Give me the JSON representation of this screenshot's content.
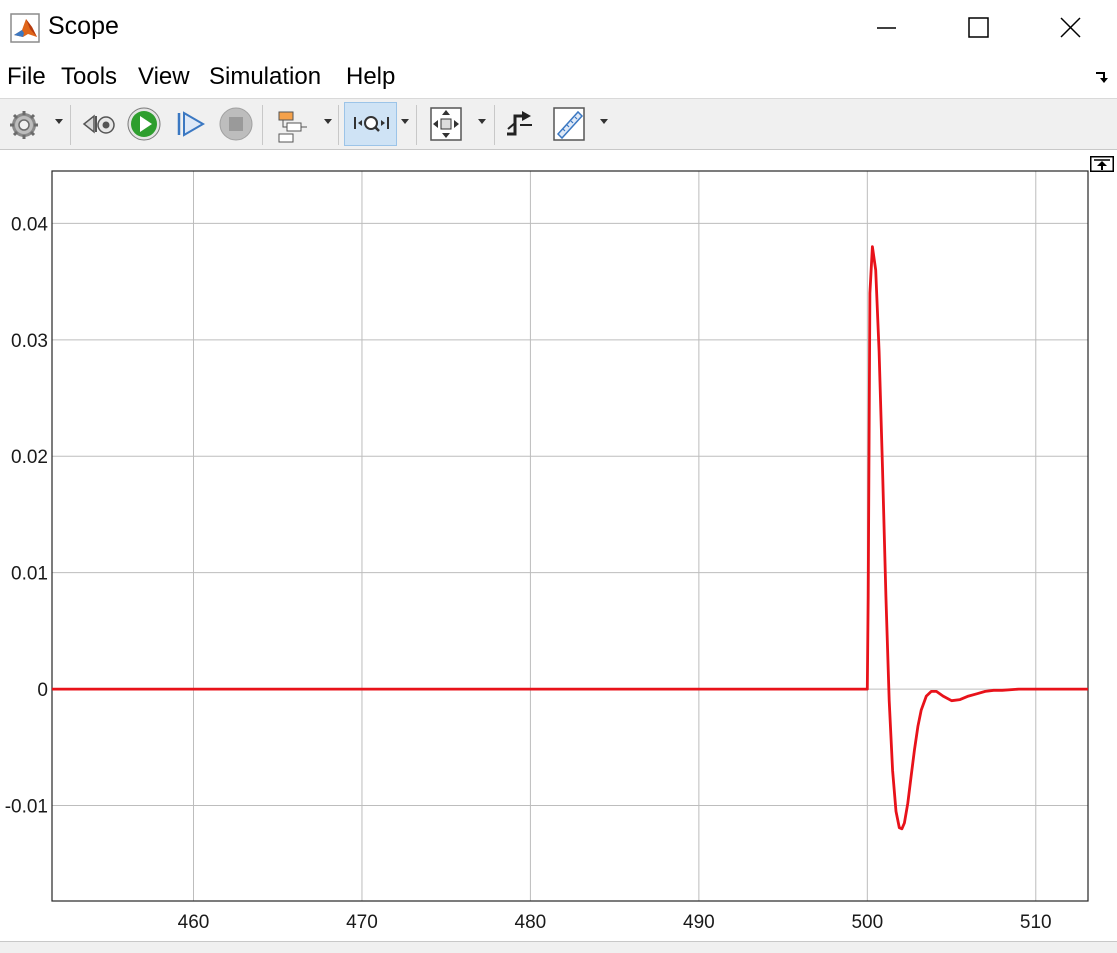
{
  "window": {
    "title": "Scope"
  },
  "menu": {
    "file": "File",
    "tools": "Tools",
    "view": "View",
    "simulation": "Simulation",
    "help": "Help"
  },
  "toolbar": {
    "icons": [
      "gear-icon",
      "step-back-icon",
      "run-icon",
      "step-forward-icon",
      "stop-icon",
      "signal-hierarchy-icon",
      "zoom-icon",
      "autoscale-icon",
      "trigger-icon",
      "measurement-ruler-icon"
    ],
    "selected": "zoom-icon"
  },
  "colors": {
    "trace": "#e8121a",
    "grid": "#bdbdbd",
    "axes": "#262626",
    "run_green": "#2e9e2e"
  },
  "chart_data": {
    "type": "line",
    "title": "",
    "xlabel": "",
    "ylabel": "",
    "xlim": [
      451.6,
      513.1
    ],
    "ylim": [
      -0.0182,
      0.0445
    ],
    "xticks": [
      460,
      470,
      480,
      490,
      500,
      510
    ],
    "xtick_labels": [
      "460",
      "470",
      "480",
      "490",
      "500",
      "510"
    ],
    "yticks": [
      -0.01,
      0,
      0.01,
      0.02,
      0.03,
      0.04
    ],
    "ytick_labels": [
      "-0.01",
      "0",
      "0.01",
      "0.02",
      "0.03",
      "0.04"
    ],
    "grid": true,
    "series": [
      {
        "color": "#e8121a",
        "x": [
          451.6,
          500.0,
          500.05,
          500.15,
          500.3,
          500.5,
          500.7,
          500.9,
          501.1,
          501.3,
          501.5,
          501.7,
          501.9,
          502.05,
          502.2,
          502.4,
          502.6,
          502.8,
          503.0,
          503.2,
          503.5,
          503.8,
          504.1,
          504.5,
          505.0,
          505.5,
          506.0,
          506.5,
          507.0,
          507.5,
          508.0,
          509.0,
          510.0,
          511.0,
          512.0,
          513.1
        ],
        "y": [
          0,
          0,
          0.008,
          0.034,
          0.038,
          0.036,
          0.029,
          0.019,
          0.008,
          -0.001,
          -0.007,
          -0.0105,
          -0.0119,
          -0.012,
          -0.0115,
          -0.0098,
          -0.0075,
          -0.0052,
          -0.0032,
          -0.0018,
          -0.0006,
          -0.0002,
          -0.0002,
          -0.0006,
          -0.001,
          -0.0009,
          -0.0006,
          -0.0004,
          -0.0002,
          -0.0001,
          -0.0001,
          0,
          0,
          0,
          0,
          0
        ]
      }
    ]
  }
}
